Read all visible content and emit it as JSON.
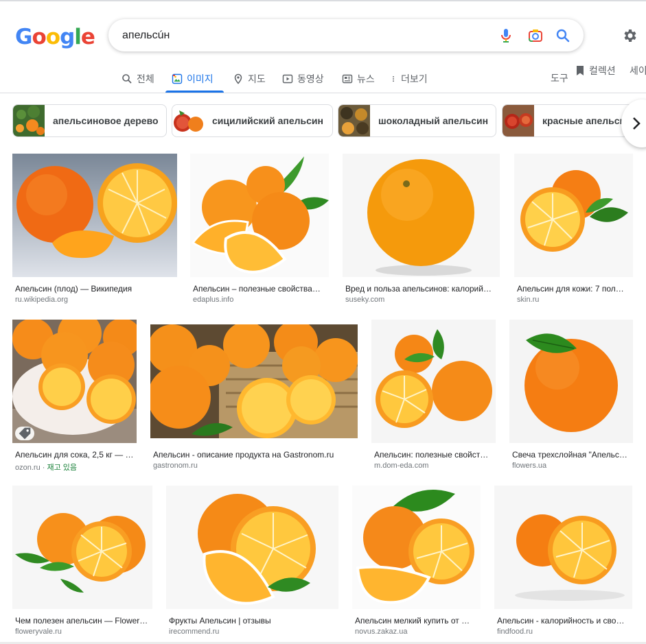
{
  "logo": [
    "G",
    "o",
    "o",
    "g",
    "l",
    "e"
  ],
  "search": {
    "query": "апельсúн"
  },
  "tabs": [
    {
      "label": "전체",
      "icon": "search-icon"
    },
    {
      "label": "이미지",
      "icon": "image-icon"
    },
    {
      "label": "지도",
      "icon": "map-pin-icon"
    },
    {
      "label": "동영상",
      "icon": "video-icon"
    },
    {
      "label": "뉴스",
      "icon": "news-icon"
    },
    {
      "label": "더보기",
      "icon": "more-icon"
    }
  ],
  "tools": {
    "tools_label": "도구",
    "collections_label": "컬렉션",
    "safesearch_label": "세이프서치"
  },
  "chips": [
    {
      "label": "апельсиновое дерево"
    },
    {
      "label": "сицилийский апельсин"
    },
    {
      "label": "шоколадный апельсин"
    },
    {
      "label": "красные апельсины"
    }
  ],
  "results": [
    {
      "title": "Апельсин (плод) — Википедия",
      "source": "ru.wikipedia.org"
    },
    {
      "title": "Апельсин – полезные свойства…",
      "source": "edaplus.info"
    },
    {
      "title": "Вред и польза апельсинов: калорий…",
      "source": "suseky.com"
    },
    {
      "title": "Апельсин для кожи: 7 пол…",
      "source": "skin.ru"
    },
    {
      "title": "Апельсин для сока, 2,5 кг — …",
      "source": "ozon.ru",
      "stock": "재고 있음"
    },
    {
      "title": "Апельсин - описание продукта на Gastronom.ru",
      "source": "gastronom.ru"
    },
    {
      "title": "Апельсин: полезные свойст…",
      "source": "m.dom-eda.com"
    },
    {
      "title": "Свеча трехслойная \"Апельс…",
      "source": "flowers.ua"
    },
    {
      "title": "Чем полезен апельсин — Flower…",
      "source": "floweryvale.ru"
    },
    {
      "title": "Фрукты Апельсин | отзывы",
      "source": "irecommend.ru"
    },
    {
      "title": "Апельсин мелкий купить от …",
      "source": "novus.zakaz.ua"
    },
    {
      "title": "Апельсин - калорийность и сво…",
      "source": "findfood.ru"
    }
  ],
  "colors": {
    "accent": "#1a73e8",
    "orange": "#f7941d",
    "pulp": "#ffb62e",
    "leaf": "#2e8b2e"
  }
}
